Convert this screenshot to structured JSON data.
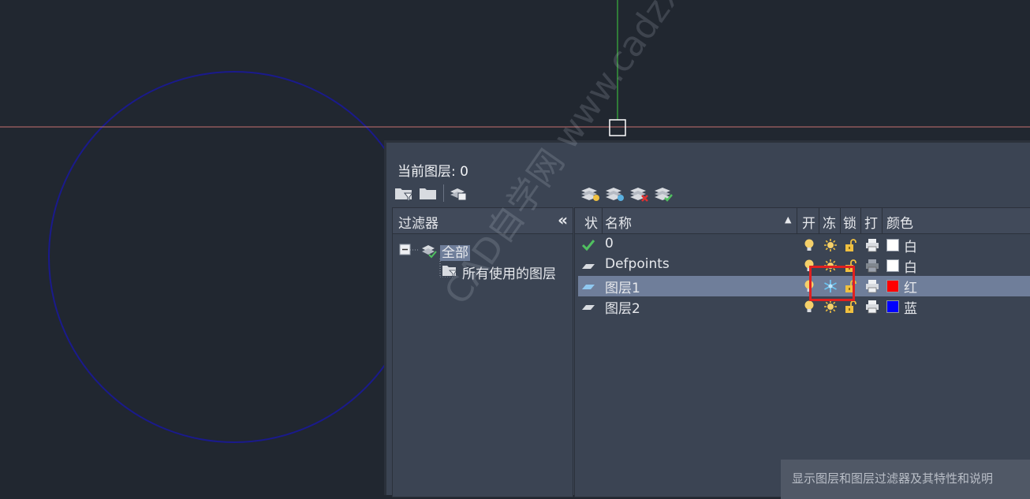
{
  "palette": {
    "current_layer": "当前图层: 0",
    "filter_header": "过滤器",
    "collapse_icon": "«",
    "tree": {
      "root": "全部",
      "child": "所有使用的图层"
    },
    "columns": {
      "status": "状",
      "name": "名称",
      "on": "开",
      "freeze": "冻",
      "lock": "锁",
      "plot": "打",
      "color": "颜色"
    },
    "layers": [
      {
        "name": "0",
        "status": "current",
        "frozen": false,
        "plot_disabled": false,
        "color_name": "白",
        "color": "#ffffff"
      },
      {
        "name": "Defpoints",
        "status": "normal",
        "frozen": false,
        "plot_disabled": true,
        "color_name": "白",
        "color": "#ffffff"
      },
      {
        "name": "图层1",
        "status": "normal",
        "frozen": true,
        "plot_disabled": false,
        "color_name": "红",
        "color": "#ff0000"
      },
      {
        "name": "图层2",
        "status": "normal",
        "frozen": false,
        "plot_disabled": false,
        "color_name": "蓝",
        "color": "#0000ff"
      }
    ],
    "selected_row": 2
  },
  "tooltip": "显示图层和图层过滤器及其特性和说明",
  "watermark": "CAD自学网 www.cadzxw.com",
  "colors": {
    "canvas_bg": "#212730",
    "circle": "#1a1a8c",
    "crosshair_h": "#c87070",
    "crosshair_v": "#40d040",
    "highlight": "#e02020"
  },
  "icons": {
    "toolbar_left": [
      "new-property-filter-icon",
      "new-group-filter-icon",
      "layer-states-manager-icon"
    ],
    "toolbar_right": [
      "new-layer-icon",
      "new-layer-vp-frozen-icon",
      "delete-layer-icon",
      "set-current-icon"
    ],
    "row": [
      "lightbulb-on-icon",
      "sun-thawed-icon",
      "snowflake-frozen-icon",
      "lock-open-icon",
      "printer-icon"
    ]
  }
}
